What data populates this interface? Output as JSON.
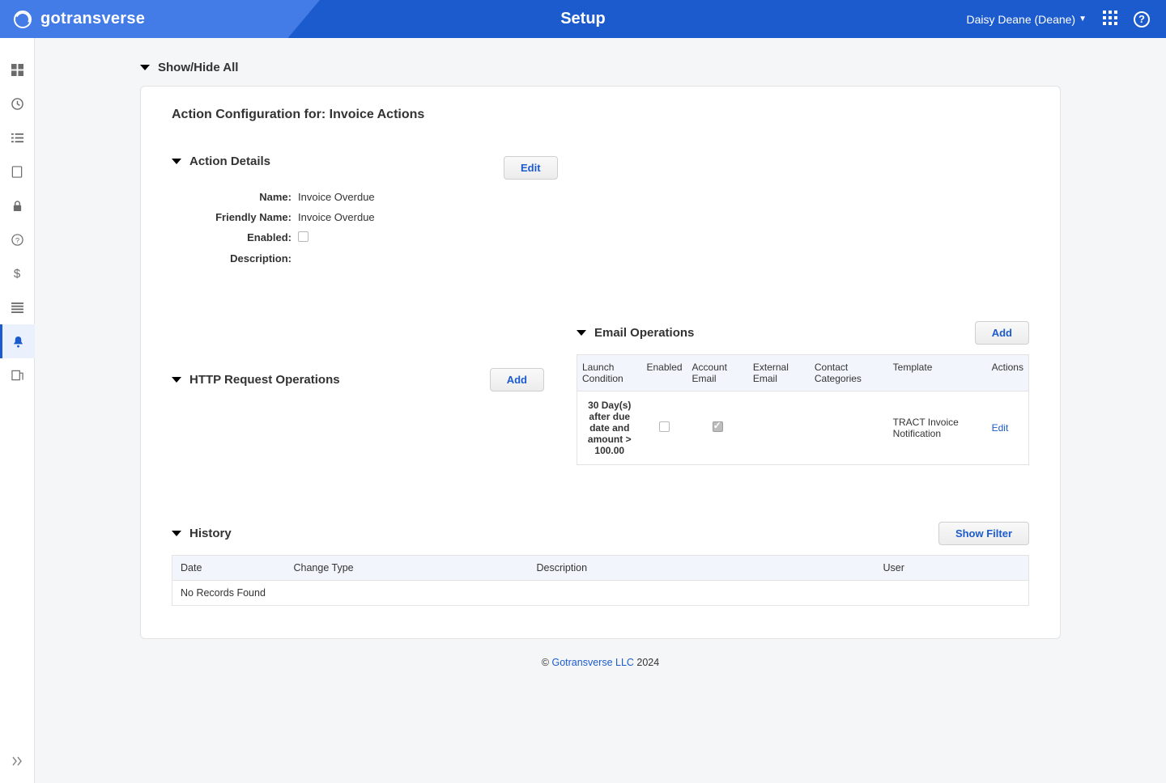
{
  "header": {
    "brand": "gotransverse",
    "title": "Setup",
    "user": "Daisy Deane (Deane)"
  },
  "sidebar": {
    "items": [
      {
        "icon": "grid-icon"
      },
      {
        "icon": "clock-icon"
      },
      {
        "icon": "list-icon"
      },
      {
        "icon": "page-icon"
      },
      {
        "icon": "lock-icon"
      },
      {
        "icon": "help-circle-icon"
      },
      {
        "icon": "dollar-icon"
      },
      {
        "icon": "lines-icon"
      },
      {
        "icon": "bell-icon",
        "active": true
      },
      {
        "icon": "report-icon"
      }
    ]
  },
  "page": {
    "show_hide": "Show/Hide All",
    "panel_title": "Action Configuration for: Invoice Actions",
    "action_details": {
      "header": "Action Details",
      "edit_label": "Edit",
      "name_label": "Name:",
      "name_value": "Invoice Overdue",
      "friendly_label": "Friendly Name:",
      "friendly_value": "Invoice Overdue",
      "enabled_label": "Enabled:",
      "description_label": "Description:",
      "description_value": ""
    },
    "http_ops": {
      "header": "HTTP Request Operations",
      "add_label": "Add"
    },
    "email_ops": {
      "header": "Email Operations",
      "add_label": "Add",
      "columns": {
        "launch": "Launch Condition",
        "enabled": "Enabled",
        "acct_email": "Account Email",
        "ext_email": "External Email",
        "contact_cat": "Contact Categories",
        "template": "Template",
        "actions": "Actions"
      },
      "row": {
        "launch": "30 Day(s) after due date and amount > 100.00",
        "template": "TRACT Invoice Notification",
        "edit": "Edit"
      }
    },
    "history": {
      "header": "History",
      "show_filter": "Show Filter",
      "columns": {
        "date": "Date",
        "change_type": "Change Type",
        "description": "Description",
        "user": "User"
      },
      "empty": "No Records Found"
    }
  },
  "footer": {
    "copyright": "©",
    "link": "Gotransverse LLC",
    "year": "2024"
  }
}
